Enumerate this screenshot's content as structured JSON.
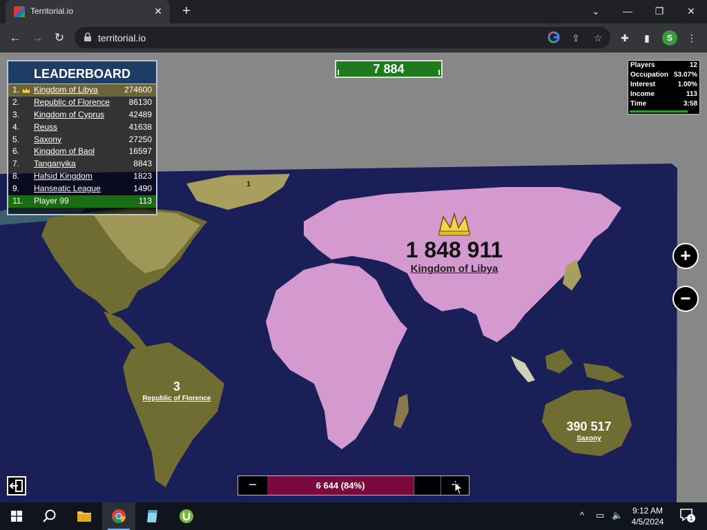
{
  "browser": {
    "tab_title": "Territorial.io",
    "url": "territorial.io",
    "profile_initial": "S",
    "icons": [
      "back-arrow-icon",
      "forward-arrow-icon",
      "reload-icon",
      "lock-icon",
      "google-icon",
      "share-icon",
      "star-icon",
      "puzzle-icon",
      "sidebar-icon",
      "more-icon"
    ]
  },
  "leaderboard": {
    "title": "LEADERBOARD",
    "rows": [
      {
        "rank": "1.",
        "name": "Kingdom of Libya",
        "score": "274600"
      },
      {
        "rank": "2.",
        "name": "Republic of Florence",
        "score": "86130"
      },
      {
        "rank": "3.",
        "name": "Kingdom of Cyprus",
        "score": "42489"
      },
      {
        "rank": "4.",
        "name": "Reuss",
        "score": "41638"
      },
      {
        "rank": "5.",
        "name": "Saxony",
        "score": "27250"
      },
      {
        "rank": "6.",
        "name": "Kingdom of Baol",
        "score": "16597"
      },
      {
        "rank": "7.",
        "name": "Tanganyika",
        "score": "8843"
      },
      {
        "rank": "8.",
        "name": "Hafsid Kingdom",
        "score": "1823"
      },
      {
        "rank": "9.",
        "name": "Hanseatic League",
        "score": "1490"
      },
      {
        "rank": "11.",
        "name": "Player 99",
        "score": "113"
      }
    ]
  },
  "balance": "7 884",
  "stats": {
    "rows": [
      {
        "label": "Players",
        "value": "12"
      },
      {
        "label": "Occupation",
        "value": "53.07%"
      },
      {
        "label": "Interest",
        "value": "1.00%"
      },
      {
        "label": "Income",
        "value": "113"
      },
      {
        "label": "Time",
        "value": "3:58"
      }
    ],
    "progress": 0.85
  },
  "map_labels": {
    "libya_count": "1 848 911",
    "libya_name": "Kingdom of Libya",
    "florence_count": "3",
    "florence_name": "Republic of Florence",
    "saxony_count": "390 517",
    "saxony_name": "Saxony",
    "north_count": "1"
  },
  "troop_control": {
    "minus": "−",
    "value": "6 644 (84%)",
    "plus": "+"
  },
  "zoom": {
    "in": "+",
    "out": "−"
  },
  "taskbar": {
    "time": "9:12 AM",
    "date": "4/5/2024",
    "notifications": "1"
  },
  "colors": {
    "ocean": "#1b1f58",
    "libya": "#d499cf",
    "florence": "#6f6d32",
    "north": "#a89f5e",
    "balance_green": "#1e7a1b",
    "troop_bar": "#7b0a3c"
  }
}
